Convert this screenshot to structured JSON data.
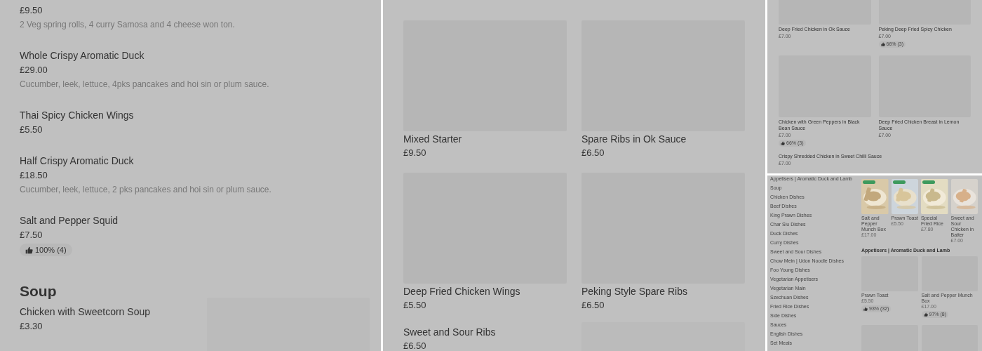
{
  "left_panel": {
    "items": [
      {
        "kind": "dish",
        "price": "£9.50",
        "description": "2 Veg spring rolls, 4 curry Samosa and 4 cheese won ton.",
        "image": false
      },
      {
        "kind": "dish",
        "name": "Whole Crispy Aromatic Duck",
        "price": "£29.00",
        "description": "Cucumber, leek, lettuce, 4pks pancakes and hoi sin or plum sauce.",
        "image": false
      },
      {
        "kind": "dish",
        "name": "Thai Spicy Chicken Wings",
        "price": "£5.50",
        "image": false
      },
      {
        "kind": "dish",
        "name": "Half Crispy Aromatic Duck",
        "price": "£18.50",
        "description": "Cucumber, leek, lettuce, 2 pks pancakes and hoi sin or plum sauce.",
        "image": false
      },
      {
        "kind": "dish",
        "name": "Salt and Pepper Squid",
        "price": "£7.50",
        "rating": "100% (4)",
        "image": false
      },
      {
        "kind": "heading",
        "name": "Soup"
      },
      {
        "kind": "dish",
        "name": "Chicken with Sweetcorn Soup",
        "price": "£3.30",
        "image": true
      }
    ]
  },
  "middle_panel": {
    "cards": [
      {
        "name": "Mixed Starter",
        "price": "£9.50",
        "image": true
      },
      {
        "name": "Spare Ribs in Ok Sauce",
        "price": "£6.50",
        "image": true
      },
      {
        "name": "Deep Fried Chicken Wings",
        "price": "£5.50",
        "image": true
      },
      {
        "name": "Peking Style Spare Ribs",
        "price": "£6.50",
        "image": true
      },
      {
        "name": "Sweet and Sour Ribs",
        "price": "£6.50",
        "image": false
      }
    ]
  },
  "right_top_panel": {
    "cards": [
      {
        "name": "Deep Fried Chicken in Ok Sauce",
        "price": "£7.00",
        "image": true
      },
      {
        "name": "Peking Deep Fried Spicy Chicken",
        "price": "£7.00",
        "rating": "66% (3)",
        "image": true
      },
      {
        "name": "Chicken with Green Peppers in Black Bean Sauce",
        "price": "£7.00",
        "rating": "66% (3)",
        "image": true
      },
      {
        "name": "Deep Fried Chicken Breast in Lemon Sauce",
        "price": "£7.00",
        "image": true
      },
      {
        "name": "Crispy Shredded Chicken in Sweet Chilli Sauce",
        "price": "£7.00",
        "image": false
      }
    ]
  },
  "right_bottom_panel": {
    "sidebar": {
      "items": [
        {
          "label": "Appetisers | Aromatic Duck and Lamb"
        },
        {
          "label": "Soup"
        },
        {
          "label": "Chicken Dishes"
        },
        {
          "label": "Beef Dishes"
        },
        {
          "label": "King Prawn Dishes"
        },
        {
          "label": "Char Siu Dishes"
        },
        {
          "label": "Duck Dishes"
        },
        {
          "label": "Curry Dishes"
        },
        {
          "label": "Sweet and Sour Dishes"
        },
        {
          "label": "Chow Mein | Udon Noodle Dishes"
        },
        {
          "label": "Foo Young Dishes"
        },
        {
          "label": "Vegetarian Appetisers"
        },
        {
          "label": "Vegetarian Main"
        },
        {
          "label": "Szechuan Dishes"
        },
        {
          "label": "Fried Rice Dishes"
        },
        {
          "label": "Side Dishes"
        },
        {
          "label": "Sauces"
        },
        {
          "label": "English Dishes"
        },
        {
          "label": "Set Meals"
        }
      ]
    },
    "featured": [
      {
        "name": "Salt and Pepper Munch Box",
        "price": "£17.00",
        "tag": true
      },
      {
        "name": "Prawn Toast",
        "price": "£5.50",
        "tag": true
      },
      {
        "name": "Special Fried Rice",
        "price": "£7.80",
        "tag": true
      },
      {
        "name": "Sweet and Sour Chicken in Batter",
        "price": "£7.00",
        "tag": false
      }
    ],
    "section": {
      "title": "Appetisers | Aromatic Duck and Lamb",
      "cards": [
        {
          "name": "Prawn Toast",
          "price": "£5.50",
          "rating": "93% (32)"
        },
        {
          "name": "Salt and Pepper Munch Box",
          "price": "£17.00",
          "rating": "97% (8)"
        }
      ]
    }
  }
}
